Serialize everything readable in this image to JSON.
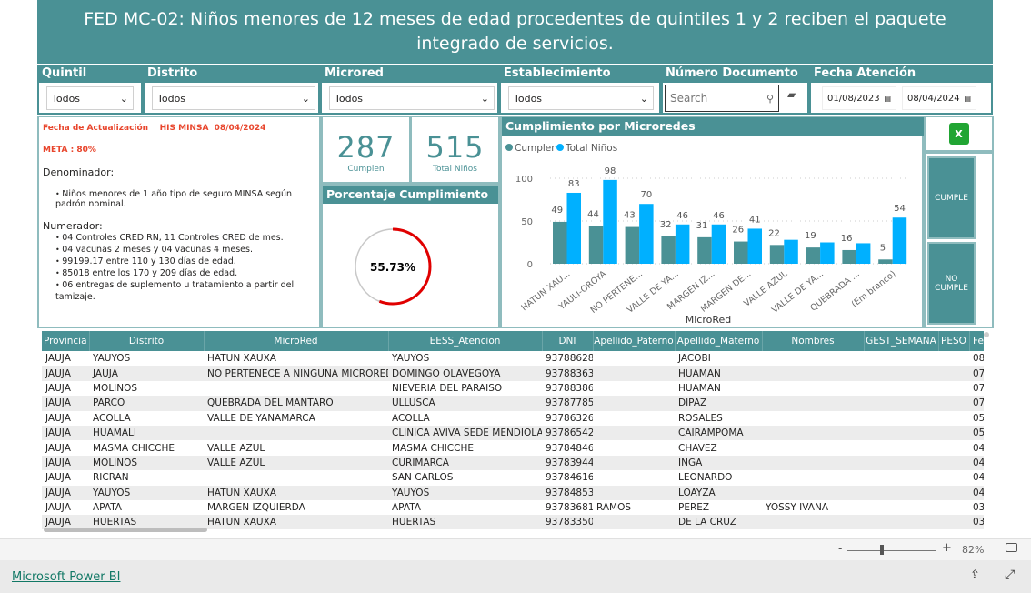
{
  "header": {
    "title": "FED MC-02: Niños menores de 12 meses de edad procedentes de quintiles 1 y 2 reciben el paquete integrado de servicios."
  },
  "filters": {
    "quintil": {
      "label": "Quintil",
      "value": "Todos"
    },
    "distrito": {
      "label": "Distrito",
      "value": "Todos"
    },
    "microred": {
      "label": "Microred",
      "value": "Todos"
    },
    "establecimiento": {
      "label": "Establecimiento",
      "value": "Todos"
    },
    "documento": {
      "label": "Número Documento",
      "placeholder": "Search"
    },
    "fecha": {
      "label": "Fecha Atención",
      "from": "01/08/2023",
      "to": "08/04/2024"
    }
  },
  "info": {
    "update": "Fecha de Actualización    HIS MINSA  08/04/2024",
    "meta": "META : 80%",
    "den_title": "Denominador:",
    "den_items": [
      "Niños menores de 1 año tipo de seguro MINSA según padrón nominal."
    ],
    "num_title": "Numerador:",
    "num_items": [
      "04 Controles CRED RN, 11 Controles CRED de mes.",
      "04 vacunas 2 meses y 04 vacunas 4 meses.",
      "99199.17  entre 110 y 130 días de edad.",
      "85018 entre los 170 y 209 días de edad.",
      "06 entregas de suplemento u tratamiento a partir del tamizaje."
    ]
  },
  "kpis": {
    "cumplen": {
      "value": "287",
      "label": "Cumplen"
    },
    "total": {
      "value": "515",
      "label": "Total Niños"
    }
  },
  "gauge": {
    "title": "Porcentaje Cumplimiento",
    "value": 55.73,
    "label": "55.73%",
    "color": "#e00000"
  },
  "buttons": {
    "cumple": "CUMPLE",
    "no_cumple": "NO CUMPLE",
    "excel_icon": "excel-icon"
  },
  "chart_data": {
    "type": "bar",
    "title": "Cumplimiento por Microredes",
    "xlabel": "MicroRed",
    "ylim": [
      0,
      100
    ],
    "yticks": [
      0,
      50,
      100
    ],
    "grid": true,
    "legend": "top-left",
    "categories": [
      "HATUN XAU...",
      "YAULI-OROYA",
      "NO PERTENE...",
      "VALLE DE YA...",
      "MARGEN IZ...",
      "MARGEN DE...",
      "VALLE AZUL",
      "VALLE DE YA...",
      "QUEBRADA ...",
      "(Em branco)"
    ],
    "series": [
      {
        "name": "Cumplen",
        "color": "#4a9195",
        "values": [
          49,
          44,
          43,
          32,
          31,
          26,
          22,
          19,
          16,
          5
        ],
        "labels": [
          "49",
          "44",
          "43",
          "32",
          "31",
          "26",
          "22",
          "19",
          "16",
          "5"
        ]
      },
      {
        "name": "Total Niños",
        "color": "#00b0ff",
        "values": [
          83,
          98,
          70,
          46,
          46,
          41,
          28,
          25,
          24,
          54
        ],
        "labels": [
          "83",
          "98",
          "70",
          "46",
          "46",
          "41",
          "",
          "",
          "",
          "54"
        ]
      }
    ]
  },
  "table": {
    "columns": [
      "Provincia",
      "Distrito",
      "MicroRed",
      "EESS_Atencion",
      "DNI",
      "Apellido_Paterno",
      "Apellido_Materno",
      "Nombres",
      "GEST_SEMANA",
      "PESO",
      "Fe"
    ],
    "rows": [
      [
        "JAUJA",
        "YAUYOS",
        "HATUN XAUXA",
        "YAUYOS",
        "93788628",
        "",
        "JACOBI",
        "",
        "",
        "",
        "08"
      ],
      [
        "JAUJA",
        "JAUJA",
        "NO PERTENECE A NINGUNA MICRORED",
        "DOMINGO OLAVEGOYA",
        "93788363",
        "",
        "HUAMAN",
        "",
        "",
        "",
        "07"
      ],
      [
        "JAUJA",
        "MOLINOS",
        "",
        "NIEVERIA DEL PARAISO",
        "93788386",
        "",
        "HUAMAN",
        "",
        "",
        "",
        "07"
      ],
      [
        "JAUJA",
        "PARCO",
        "QUEBRADA DEL MANTARO",
        "ULLUSCA",
        "93787785",
        "",
        "DIPAZ",
        "",
        "",
        "",
        "07"
      ],
      [
        "JAUJA",
        "ACOLLA",
        "VALLE DE YANAMARCA",
        "ACOLLA",
        "93786326",
        "",
        "ROSALES",
        "",
        "",
        "",
        "05"
      ],
      [
        "JAUJA",
        "HUAMALI",
        "",
        "CLINICA AVIVA SEDE MENDIOLA",
        "93786542",
        "",
        "CAIRAMPOMA",
        "",
        "",
        "",
        "05"
      ],
      [
        "JAUJA",
        "MASMA CHICCHE",
        "VALLE AZUL",
        "MASMA CHICCHE",
        "93784846",
        "",
        "CHAVEZ",
        "",
        "",
        "",
        "04"
      ],
      [
        "JAUJA",
        "MOLINOS",
        "VALLE AZUL",
        "CURIMARCA",
        "93783944",
        "",
        "INGA",
        "",
        "",
        "",
        "04"
      ],
      [
        "JAUJA",
        "RICRAN",
        "",
        "SAN CARLOS",
        "93784616",
        "",
        "LEONARDO",
        "",
        "",
        "",
        "04"
      ],
      [
        "JAUJA",
        "YAUYOS",
        "HATUN XAUXA",
        "YAUYOS",
        "93784853",
        "",
        "LOAYZA",
        "",
        "",
        "",
        "04"
      ],
      [
        "JAUJA",
        "APATA",
        "MARGEN IZQUIERDA",
        "APATA",
        "93783681",
        "RAMOS",
        "PEREZ",
        "YOSSY IVANA",
        "",
        "",
        "03"
      ],
      [
        "JAUJA",
        "HUERTAS",
        "HATUN XAUXA",
        "HUERTAS",
        "93783350",
        "",
        "DE LA CRUZ",
        "",
        "",
        "",
        "03"
      ]
    ]
  },
  "footer": {
    "zoom": "82%",
    "minus": "-",
    "plus": "+",
    "brand": "Microsoft Power BI"
  }
}
